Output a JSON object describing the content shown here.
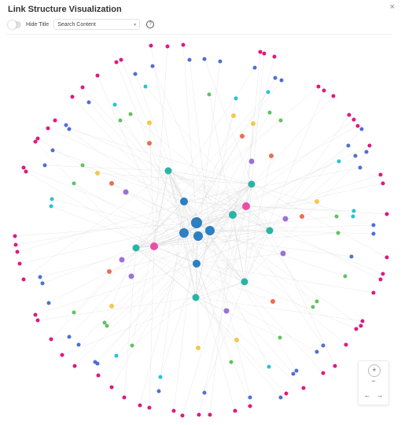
{
  "window": {
    "title": "Link Structure Visualization",
    "close_glyph": "×"
  },
  "controls": {
    "hide_title_label": "Hide Title",
    "hide_title_on": false,
    "search_placeholder": "Search Content",
    "help_glyph": "?"
  },
  "zoom_controls": {
    "zoom_in": "+",
    "zoom_out": "−",
    "pan_left": "←",
    "pan_right": "→"
  },
  "colors": {
    "blue": "#2b7fc3",
    "pink": "#e94fa6",
    "teal": "#2bb3a6",
    "purple": "#9b72d6",
    "orange": "#ef6c4f",
    "yellow": "#f5c84a",
    "green": "#5ec262",
    "cyan": "#27c2d8",
    "indigo": "#4f6fd1",
    "magenta": "#e0187f",
    "edge": "#d6d6d6"
  },
  "icons": [
    "toggle-switch",
    "chevron-down-icon",
    "help-circle-icon",
    "close-icon",
    "zoom-in-icon",
    "zoom-out-icon",
    "arrow-left-icon",
    "arrow-right-icon"
  ]
}
